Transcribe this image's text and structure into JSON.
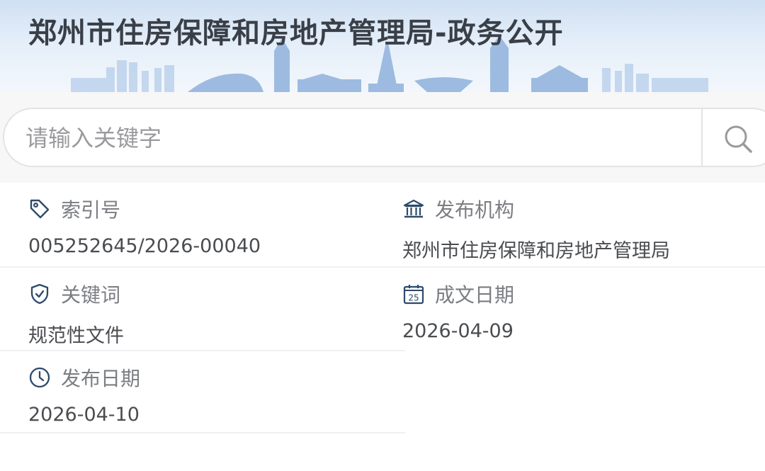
{
  "header": {
    "title": "郑州市住房保障和房地产管理局-政务公开"
  },
  "search": {
    "placeholder": "请输入关键字",
    "value": ""
  },
  "info": {
    "index_no": {
      "label": "索引号",
      "value": "005252645/2026-00040",
      "icon": "tag-icon"
    },
    "publisher": {
      "label": "发布机构",
      "value": "郑州市住房保障和房地产管理局",
      "icon": "institution-icon"
    },
    "keywords": {
      "label": "关键词",
      "value": "规范性文件",
      "icon": "shield-check-icon"
    },
    "created_date": {
      "label": "成文日期",
      "value": "2026-04-09",
      "icon": "calendar-icon",
      "icon_text": "25"
    },
    "publish_date": {
      "label": "发布日期",
      "value": "2026-04-10",
      "icon": "clock-icon"
    }
  },
  "colors": {
    "icon_blue": "#2d4a6a",
    "label_gray": "#7b7d82",
    "value_gray": "#4a4c50",
    "skyline_blue": "#9dbbe0"
  }
}
